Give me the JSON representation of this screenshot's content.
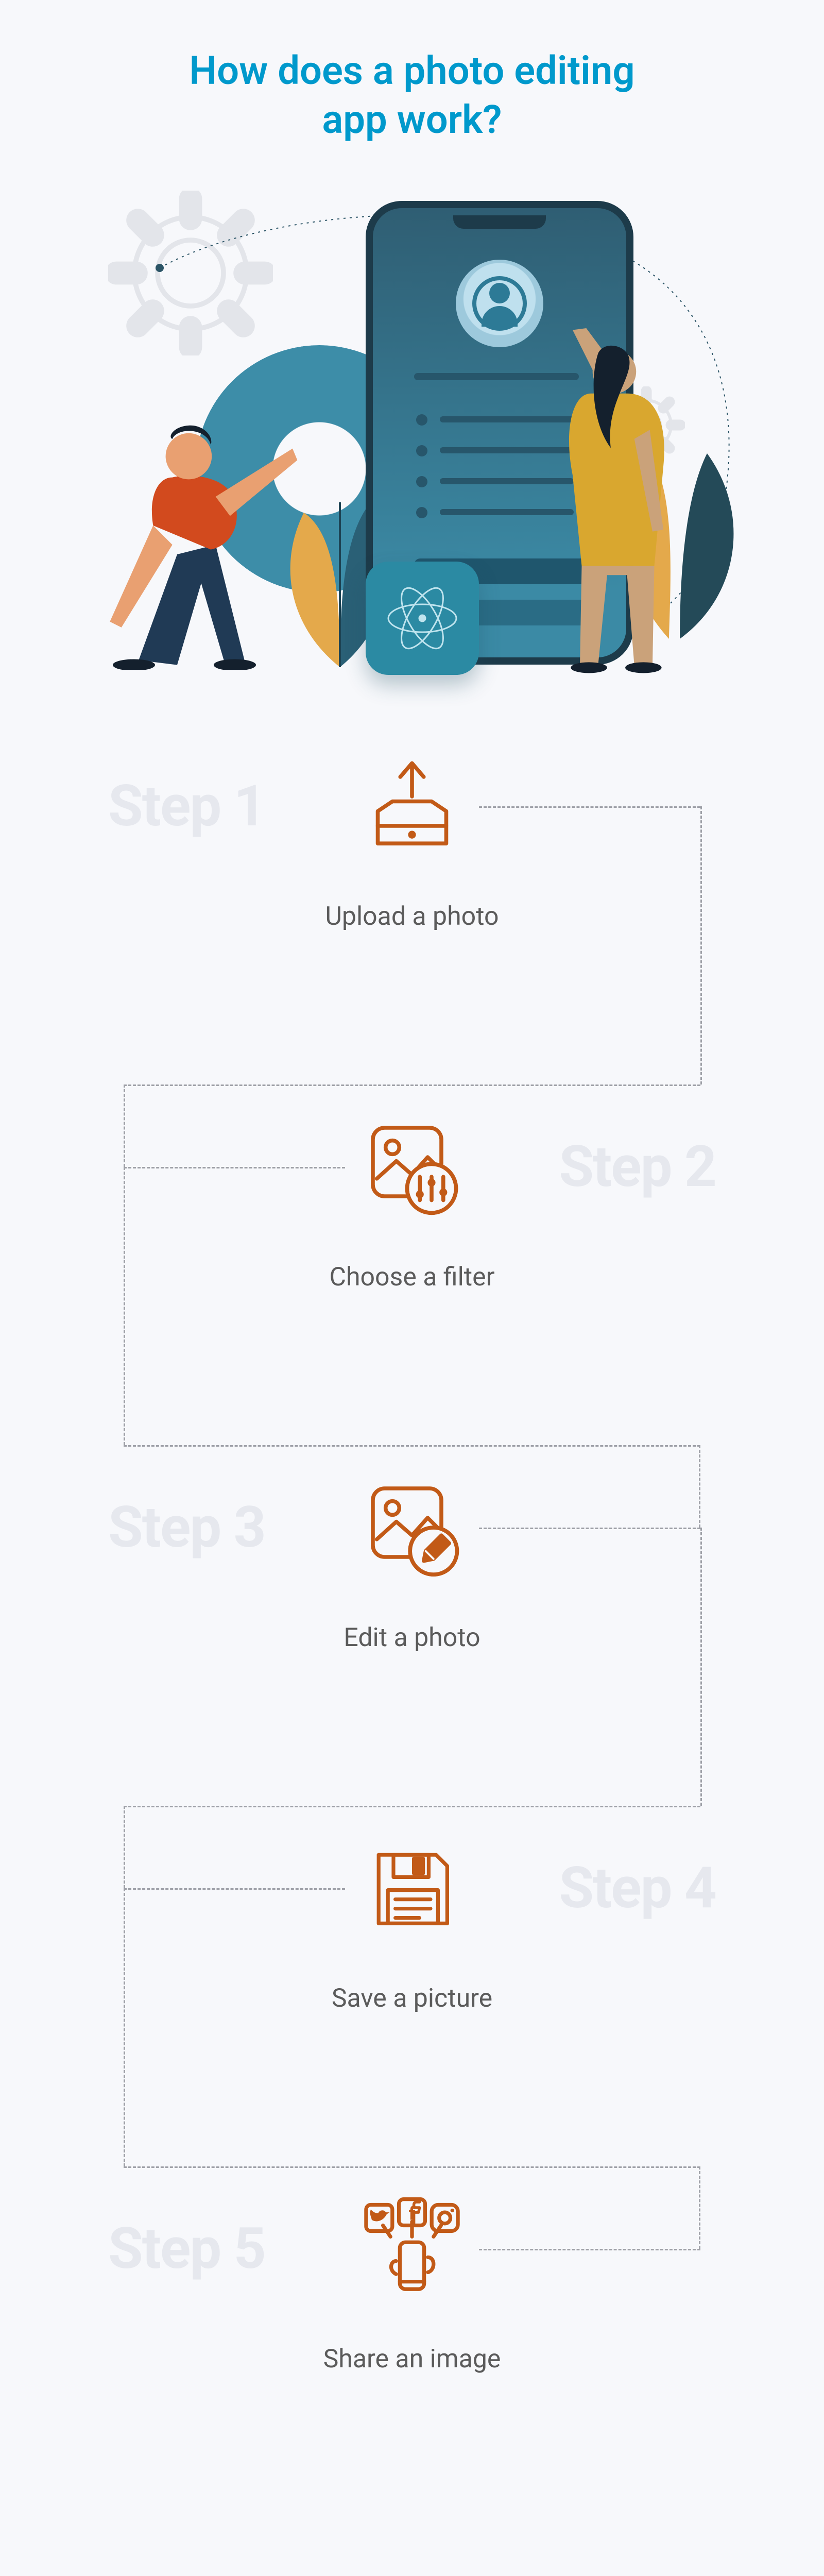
{
  "title_line1": "How does a photo editing",
  "title_line2": "app work?",
  "colors": {
    "title": "#0099cc",
    "step_label": "#e6e8ee",
    "icon": "#c25a17",
    "caption": "#5b5b5b"
  },
  "steps": [
    {
      "label": "Step 1",
      "caption": "Upload a photo",
      "side": "left",
      "icon": "upload-icon"
    },
    {
      "label": "Step 2",
      "caption": "Choose a filter",
      "side": "right",
      "icon": "filter-icon"
    },
    {
      "label": "Step 3",
      "caption": "Edit a photo",
      "side": "left",
      "icon": "edit-photo-icon"
    },
    {
      "label": "Step 4",
      "caption": "Save a picture",
      "side": "right",
      "icon": "floppy-save-icon"
    },
    {
      "label": "Step 5",
      "caption": "Share an image",
      "side": "left",
      "icon": "share-social-icon"
    }
  ]
}
